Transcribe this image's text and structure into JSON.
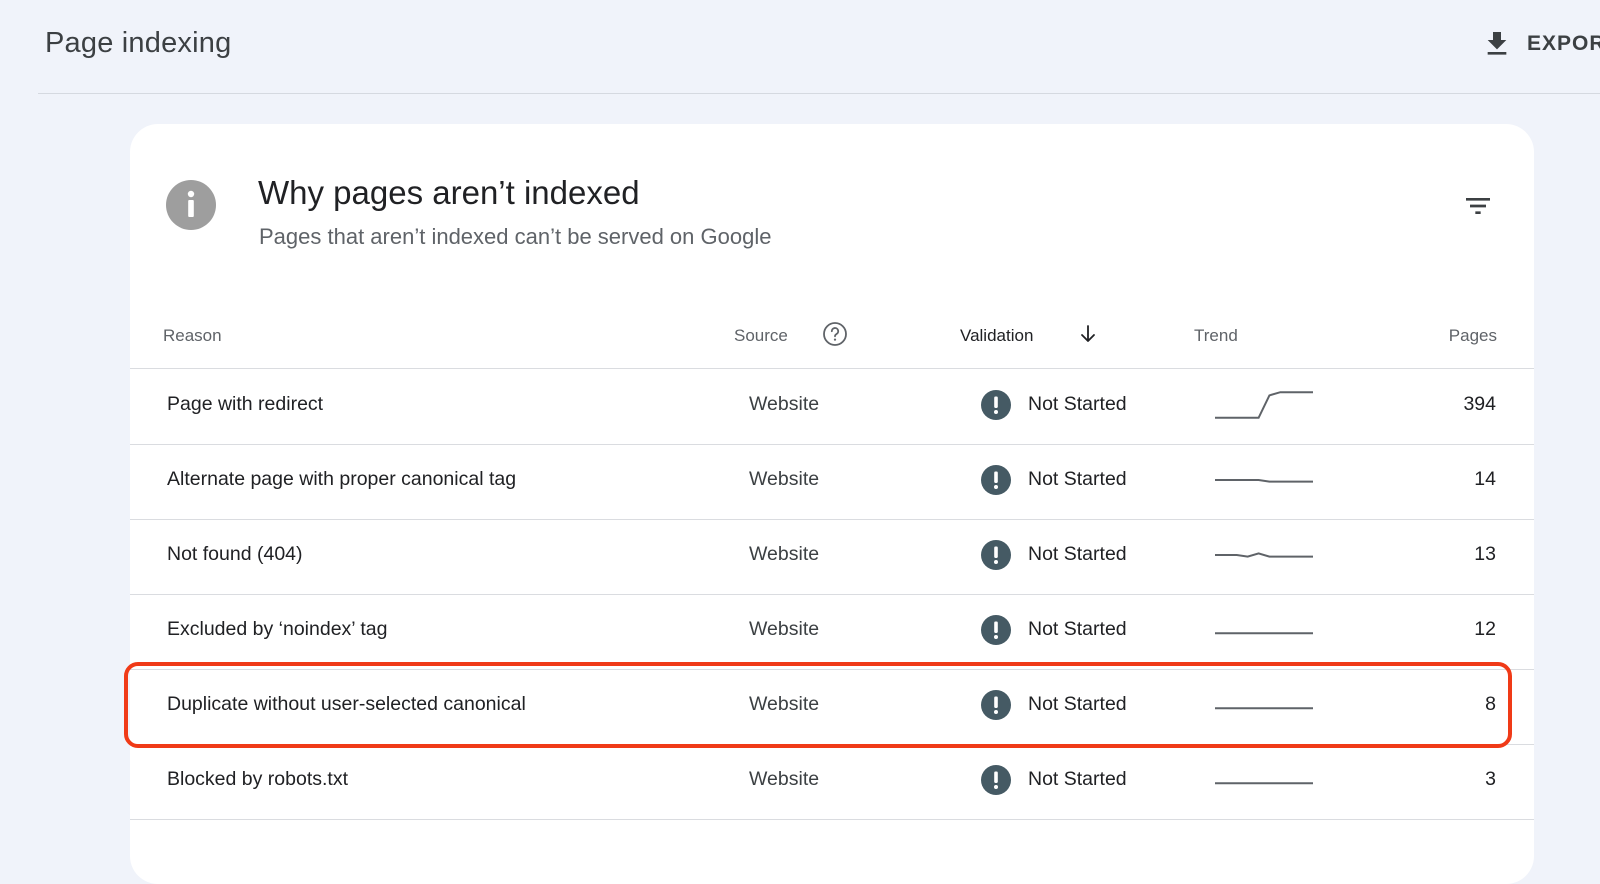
{
  "header": {
    "title": "Page indexing",
    "export_label": "EXPOR",
    "export_icon": "download-icon"
  },
  "card": {
    "title": "Why pages aren’t indexed",
    "subtitle": "Pages that aren’t indexed can’t be served on Google",
    "icon": "info-icon",
    "filter_icon": "filter-icon"
  },
  "table": {
    "columns": {
      "reason": "Reason",
      "source": "Source",
      "validation": "Validation",
      "trend": "Trend",
      "pages": "Pages"
    },
    "sort_column": "validation",
    "sort_direction": "descending",
    "rows": [
      {
        "reason": "Page with redirect",
        "source": "Website",
        "validation": "Not Started",
        "pages": "394",
        "trend": [
          0.1,
          0.1,
          0.1,
          0.1,
          0.1,
          0.8,
          0.9,
          0.9,
          0.9,
          0.9
        ]
      },
      {
        "reason": "Alternate page with proper canonical tag",
        "source": "Website",
        "validation": "Not Started",
        "pages": "14",
        "trend": [
          0.5,
          0.5,
          0.5,
          0.5,
          0.5,
          0.45,
          0.45,
          0.45,
          0.45,
          0.45
        ]
      },
      {
        "reason": "Not found (404)",
        "source": "Website",
        "validation": "Not Started",
        "pages": "13",
        "trend": [
          0.5,
          0.5,
          0.5,
          0.45,
          0.55,
          0.45,
          0.45,
          0.45,
          0.45,
          0.45
        ]
      },
      {
        "reason": "Excluded by ‘noindex’ tag",
        "source": "Website",
        "validation": "Not Started",
        "pages": "12",
        "trend": [
          0.4,
          0.4,
          0.4,
          0.4,
          0.4,
          0.4,
          0.4,
          0.4,
          0.4,
          0.4
        ]
      },
      {
        "reason": "Duplicate without user-selected canonical",
        "source": "Website",
        "validation": "Not Started",
        "pages": "8",
        "trend": [
          0.4,
          0.4,
          0.4,
          0.4,
          0.4,
          0.4,
          0.4,
          0.4,
          0.4,
          0.4
        ]
      },
      {
        "reason": "Blocked by robots.txt",
        "source": "Website",
        "validation": "Not Started",
        "pages": "3",
        "trend": [
          0.4,
          0.4,
          0.4,
          0.4,
          0.4,
          0.4,
          0.4,
          0.4,
          0.4,
          0.4
        ]
      }
    ],
    "highlighted_row": 4
  },
  "colors": {
    "background": "#f0f3fa",
    "status_icon": "#455a64",
    "trend_line": "#5f6368",
    "highlight": "#f03a17"
  }
}
